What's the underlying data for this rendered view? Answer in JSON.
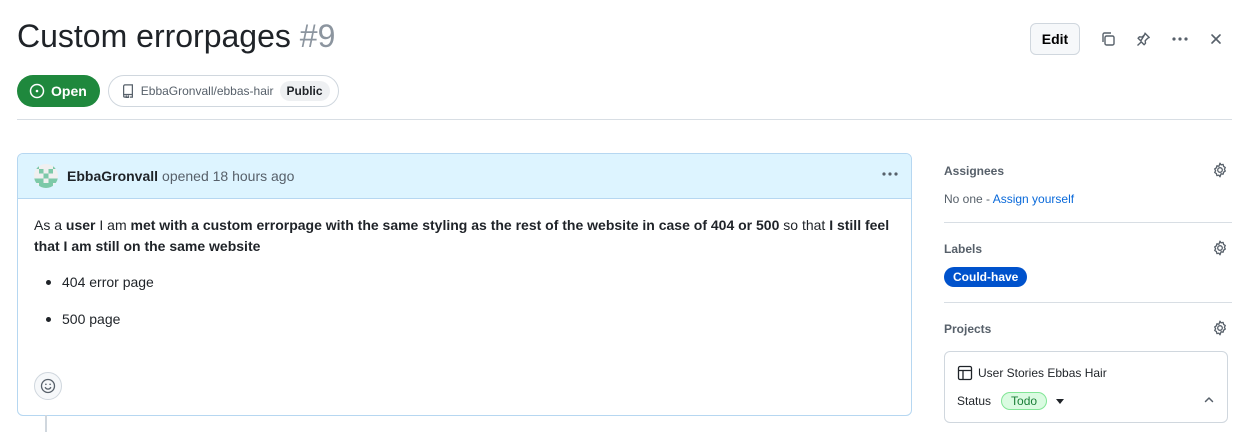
{
  "issue": {
    "title": "Custom errorpages",
    "number": "#9",
    "state": "Open",
    "repo": "EbbaGronvall/ebbas-hair",
    "visibility": "Public"
  },
  "header_actions": {
    "edit_label": "Edit"
  },
  "comment": {
    "author": "EbbaGronvall",
    "action_time": "opened 18 hours ago",
    "body": {
      "p1": "As a ",
      "p2": "user",
      "p3": " I am ",
      "p4": "met with a custom errorpage with the same styling as the rest of the website in case of 404 or 500",
      "p5": " so that ",
      "p6": "I still feel that I am still on the same website"
    },
    "bullets": [
      "404 error page",
      "500 page"
    ]
  },
  "sidebar": {
    "assignees": {
      "title": "Assignees",
      "none_text": "No one - ",
      "assign_link": "Assign yourself"
    },
    "labels": {
      "title": "Labels",
      "items": [
        {
          "name": "Could-have",
          "color": "#0052cc"
        }
      ]
    },
    "projects": {
      "title": "Projects",
      "project_name": "User Stories Ebbas Hair",
      "status_label": "Status",
      "status_value": "Todo"
    }
  },
  "colors": {
    "open_green": "#1f883d",
    "comment_header_bg": "#ddf4ff",
    "link_blue": "#0969da",
    "todo_green": "#1a7f37"
  },
  "icons": [
    "copy-icon",
    "pin-icon",
    "kebab-icon",
    "close-icon",
    "issue-opened-icon",
    "repo-icon",
    "smiley-icon",
    "gear-icon",
    "table-icon",
    "chevron-up-icon"
  ]
}
